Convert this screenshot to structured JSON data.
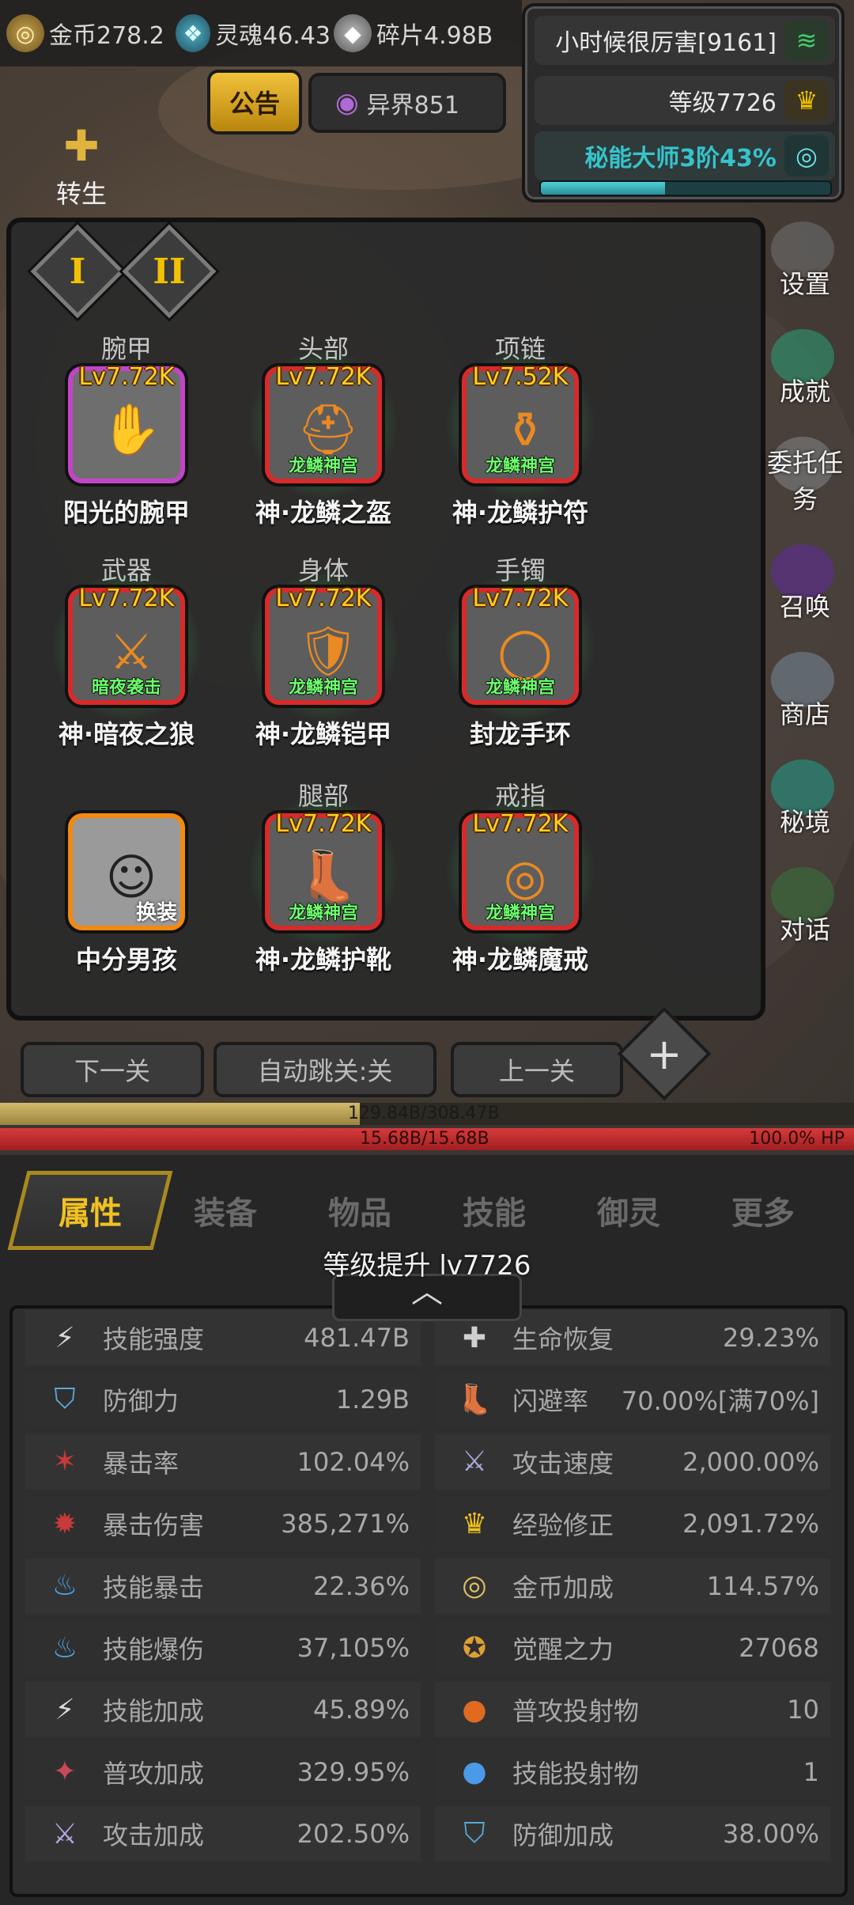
{
  "topbar": {
    "gold": "金币278.2",
    "soul": "灵魂46.43",
    "shard": "碎片4.98B"
  },
  "status": {
    "damage": "小时候很厉害[9161]",
    "level": "等级7726",
    "mastery": "秘能大师3阶43%",
    "mastery_progress": 0.43
  },
  "notice_label": "公告",
  "otherworld_label": "异界851",
  "rebirth_label": "转生",
  "side_menu": [
    "设置",
    "成就",
    "委托任务",
    "召唤",
    "商店",
    "秘境",
    "对话"
  ],
  "equipment": {
    "tabs": [
      "I",
      "II"
    ],
    "slots": [
      {
        "category": "腕甲",
        "level": "Lv7.72K",
        "tag": "",
        "name": "阳光的腕甲",
        "rarity": "purple"
      },
      {
        "category": "头部",
        "level": "Lv7.72K",
        "tag": "龙鳞神宫",
        "name": "神·龙鳞之盔",
        "rarity": "red"
      },
      {
        "category": "项链",
        "level": "Lv7.52K",
        "tag": "龙鳞神宫",
        "name": "神·龙鳞护符",
        "rarity": "red"
      },
      {
        "category": "武器",
        "level": "Lv7.72K",
        "tag": "暗夜袭击",
        "name": "神·暗夜之狼",
        "rarity": "red"
      },
      {
        "category": "身体",
        "level": "Lv7.72K",
        "tag": "龙鳞神宫",
        "name": "神·龙鳞铠甲",
        "rarity": "red"
      },
      {
        "category": "手镯",
        "level": "Lv7.72K",
        "tag": "龙鳞神宫",
        "name": "封龙手环",
        "rarity": "red"
      },
      {
        "category": "",
        "level": "",
        "tag": "换装",
        "name": "中分男孩",
        "rarity": "orange"
      },
      {
        "category": "腿部",
        "level": "Lv7.72K",
        "tag": "龙鳞神宫",
        "name": "神·龙鳞护靴",
        "rarity": "red"
      },
      {
        "category": "戒指",
        "level": "Lv7.72K",
        "tag": "龙鳞神宫",
        "name": "神·龙鳞魔戒",
        "rarity": "red"
      }
    ]
  },
  "nav": {
    "next": "下一关",
    "auto": "自动跳关:关",
    "prev": "上一关",
    "plus": "+"
  },
  "exp": {
    "value": "129.84B/308.47B",
    "percent": "42.1% EXP",
    "fraction": 0.421
  },
  "hp": {
    "value": "15.68B/15.68B",
    "percent": "100.0%  HP",
    "fraction": 1.0
  },
  "bottom_tabs": [
    "属性",
    "装备",
    "物品",
    "技能",
    "御灵",
    "更多"
  ],
  "level_up": "等级提升 lv7726",
  "stats_left": [
    {
      "label": "技能强度",
      "value": "481.47B",
      "icon": "lightning-icon"
    },
    {
      "label": "防御力",
      "value": "1.29B",
      "icon": "shield-icon"
    },
    {
      "label": "暴击率",
      "value": "102.04%",
      "icon": "crit-icon"
    },
    {
      "label": "暴击伤害",
      "value": "385,271%",
      "icon": "crit-damage-icon"
    },
    {
      "label": "技能暴击",
      "value": "22.36%",
      "icon": "blue-flame-icon"
    },
    {
      "label": "技能爆伤",
      "value": "37,105%",
      "icon": "blue-flame-icon"
    },
    {
      "label": "技能加成",
      "value": "45.89%",
      "icon": "lightning-icon"
    },
    {
      "label": "普攻加成",
      "value": "329.95%",
      "icon": "attack-icon"
    },
    {
      "label": "攻击加成",
      "value": "202.50%",
      "icon": "sword-icon"
    }
  ],
  "stats_right": [
    {
      "label": "生命恢复",
      "value": "29.23%",
      "icon": "heal-icon"
    },
    {
      "label": "闪避率",
      "value": "70.00%[满70%]",
      "icon": "boot-icon"
    },
    {
      "label": "攻击速度",
      "value": "2,000.00%",
      "icon": "swords-icon"
    },
    {
      "label": "经验修正",
      "value": "2,091.72%",
      "icon": "crown-icon"
    },
    {
      "label": "金币加成",
      "value": "114.57%",
      "icon": "coin-icon"
    },
    {
      "label": "觉醒之力",
      "value": "27068",
      "icon": "star-badge-icon"
    },
    {
      "label": "普攻投射物",
      "value": "10",
      "icon": "fire-orb-icon"
    },
    {
      "label": "技能投射物",
      "value": "1",
      "icon": "blue-orb-icon"
    },
    {
      "label": "防御加成",
      "value": "38.00%",
      "icon": "shield-icon"
    }
  ],
  "colors": {
    "accent": "#f3c221",
    "exp": "#b89a4e",
    "hp": "#c0262c",
    "mastery": "#35c4cc"
  }
}
